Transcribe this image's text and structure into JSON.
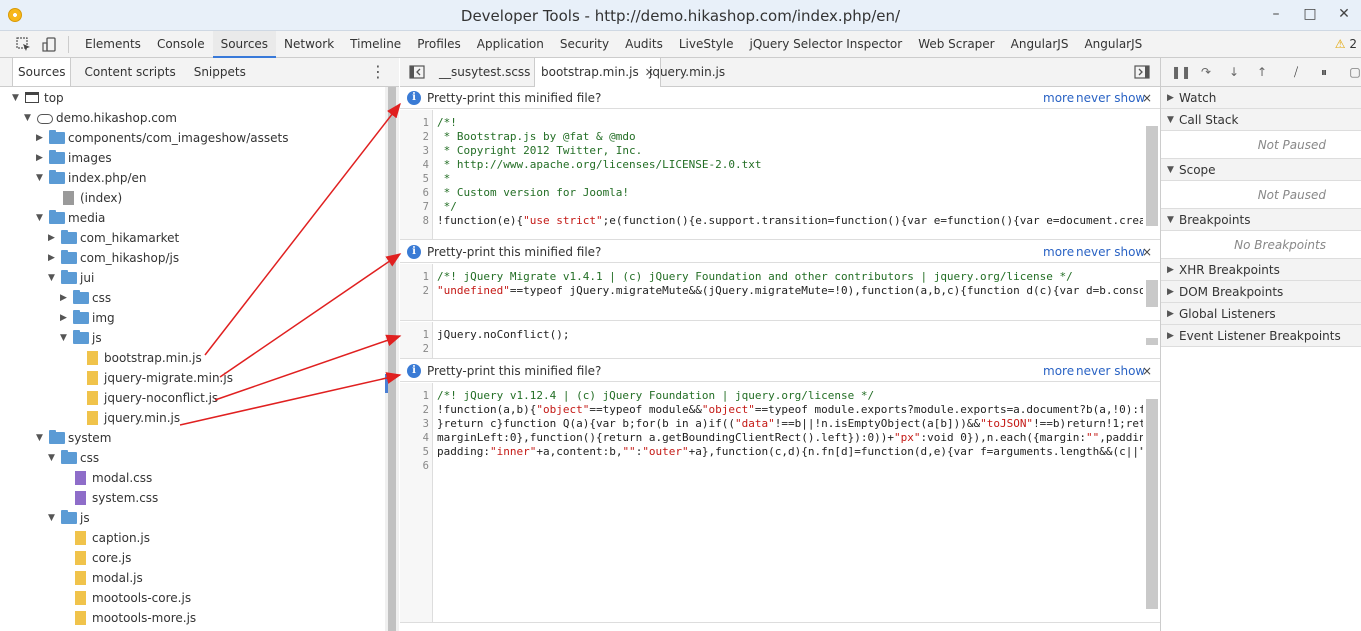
{
  "window": {
    "title": "Developer Tools - http://demo.hikashop.com/index.php/en/"
  },
  "toolbar": {
    "tabs": [
      "Elements",
      "Console",
      "Sources",
      "Network",
      "Timeline",
      "Profiles",
      "Application",
      "Security",
      "Audits",
      "LiveStyle",
      "jQuery Selector Inspector",
      "Web Scraper",
      "AngularJS",
      "AngularJS"
    ],
    "active_tab": "Sources",
    "warning_count": "2"
  },
  "navigator": {
    "tabs": [
      "Sources",
      "Content scripts",
      "Snippets"
    ],
    "tree": [
      {
        "label": "top",
        "depth": 0,
        "icon": "frame-icon",
        "expanded": true
      },
      {
        "label": "demo.hikashop.com",
        "depth": 1,
        "icon": "cloud-icon",
        "expanded": true
      },
      {
        "label": "components/com_imageshow/assets",
        "depth": 2,
        "icon": "folder-icon",
        "expanded": false
      },
      {
        "label": "images",
        "depth": 2,
        "icon": "folder-icon",
        "expanded": false
      },
      {
        "label": "index.php/en",
        "depth": 2,
        "icon": "folder-icon",
        "expanded": true
      },
      {
        "label": "(index)",
        "depth": 3,
        "icon": "file-generic-icon"
      },
      {
        "label": "media",
        "depth": 2,
        "icon": "folder-icon",
        "expanded": true
      },
      {
        "label": "com_hikamarket",
        "depth": 3,
        "icon": "folder-icon",
        "expanded": false
      },
      {
        "label": "com_hikashop/js",
        "depth": 3,
        "icon": "folder-icon",
        "expanded": false
      },
      {
        "label": "jui",
        "depth": 3,
        "icon": "folder-icon",
        "expanded": true
      },
      {
        "label": "css",
        "depth": 4,
        "icon": "folder-icon",
        "expanded": false
      },
      {
        "label": "img",
        "depth": 4,
        "icon": "folder-icon",
        "expanded": false
      },
      {
        "label": "js",
        "depth": 4,
        "icon": "folder-icon",
        "expanded": true
      },
      {
        "label": "bootstrap.min.js",
        "depth": 5,
        "icon": "file-js-icon"
      },
      {
        "label": "jquery-migrate.min.js",
        "depth": 5,
        "icon": "file-js-icon"
      },
      {
        "label": "jquery-noconflict.js",
        "depth": 5,
        "icon": "file-js-icon"
      },
      {
        "label": "jquery.min.js",
        "depth": 5,
        "icon": "file-js-icon"
      },
      {
        "label": "system",
        "depth": 2,
        "icon": "folder-icon",
        "expanded": true
      },
      {
        "label": "css",
        "depth": 3,
        "icon": "folder-icon",
        "expanded": true
      },
      {
        "label": "modal.css",
        "depth": 4,
        "icon": "file-css-icon"
      },
      {
        "label": "system.css",
        "depth": 4,
        "icon": "file-css-icon"
      },
      {
        "label": "js",
        "depth": 3,
        "icon": "folder-icon",
        "expanded": true
      },
      {
        "label": "caption.js",
        "depth": 4,
        "icon": "file-js-icon"
      },
      {
        "label": "core.js",
        "depth": 4,
        "icon": "file-js-icon"
      },
      {
        "label": "modal.js",
        "depth": 4,
        "icon": "file-js-icon"
      },
      {
        "label": "mootools-core.js",
        "depth": 4,
        "icon": "file-js-icon"
      },
      {
        "label": "mootools-more.js",
        "depth": 4,
        "icon": "file-js-icon"
      }
    ]
  },
  "editor": {
    "tabs": [
      {
        "label": "__susytest.scss",
        "active": false,
        "closable": false
      },
      {
        "label": "bootstrap.min.js",
        "active": true,
        "closable": true
      },
      {
        "label": "jquery.min.js",
        "active": false,
        "closable": false
      }
    ],
    "infobar": {
      "message": "Pretty-print this minified file?",
      "more": "more",
      "never_show": "never show",
      "close": "×"
    },
    "files": [
      {
        "prompt": true,
        "lines": [
          "/*!",
          " * Bootstrap.js by @fat & @mdo",
          " * Copyright 2012 Twitter, Inc.",
          " * http://www.apache.org/licenses/LICENSE-2.0.txt",
          " *",
          " * Custom version for Joomla!",
          " */",
          "!function(e){\"use strict\";e(function(){e.support.transition=function(){var e=function(){var e=document.crea"
        ]
      },
      {
        "prompt": true,
        "lines": [
          "/*! jQuery Migrate v1.4.1 | (c) jQuery Foundation and other contributors | jquery.org/license */",
          "\"undefined\"==typeof jQuery.migrateMute&&(jQuery.migrateMute=!0),function(a,b,c){function d(c){var d=b.conso"
        ]
      },
      {
        "prompt": false,
        "lines": [
          "jQuery.noConflict();",
          ""
        ]
      },
      {
        "prompt": true,
        "lines": [
          "/*! jQuery v1.12.4 | (c) jQuery Foundation | jquery.org/license */",
          "!function(a,b){\"object\"==typeof module&&\"object\"==typeof module.exports?module.exports=a.document?b(a,!0):f",
          "}return c}function Q(a){var b;for(b in a)if((\"data\"!==b||!n.isEmptyObject(a[b]))&&\"toJSON\"!==b)return!1;ret",
          "marginLeft:0},function(){return a.getBoundingClientRect().left}):0))+\"px\":void 0}),n.each({margin:\"\",paddin",
          "padding:\"inner\"+a,content:b,\"\":\"outer\"+a},function(c,d){n.fn[d]=function(d,e){var f=arguments.length&&(c||\"",
          ""
        ]
      }
    ]
  },
  "debugger": {
    "sections": [
      {
        "label": "Watch",
        "expanded": false
      },
      {
        "label": "Call Stack",
        "expanded": true,
        "content": "Not Paused"
      },
      {
        "label": "Scope",
        "expanded": true,
        "content": "Not Paused"
      },
      {
        "label": "Breakpoints",
        "expanded": true,
        "content": "No Breakpoints"
      },
      {
        "label": "XHR Breakpoints",
        "expanded": false
      },
      {
        "label": "DOM Breakpoints",
        "expanded": false
      },
      {
        "label": "Global Listeners",
        "expanded": false
      },
      {
        "label": "Event Listener Breakpoints",
        "expanded": false
      }
    ]
  },
  "colors": {
    "accent": "#3879d9",
    "annotation_arrow": "#e02020",
    "comment": "#236e25",
    "string": "#c41a16",
    "link": "#2a63c4"
  }
}
